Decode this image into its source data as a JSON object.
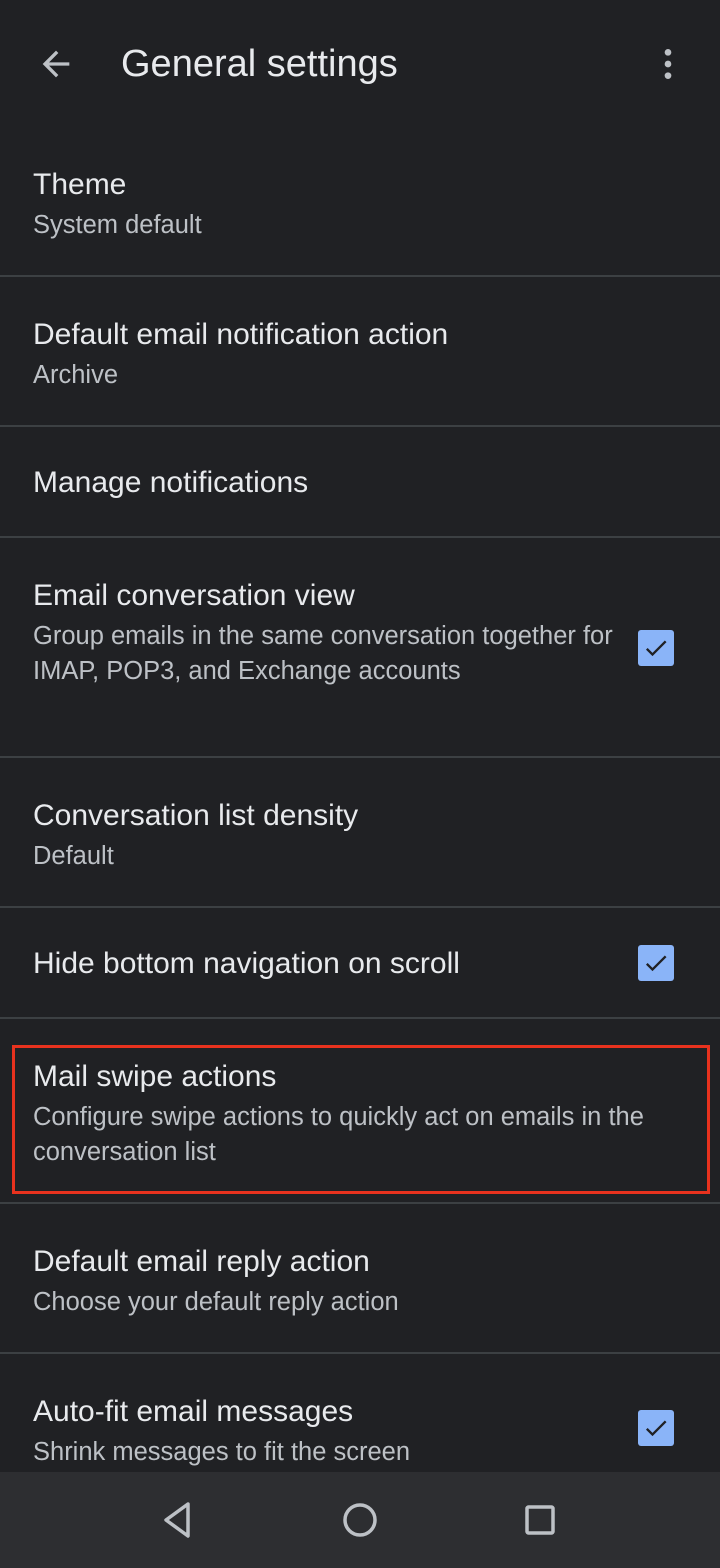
{
  "app_bar": {
    "title": "General settings",
    "back_icon": "arrow-left-icon",
    "overflow_icon": "more-vert-icon"
  },
  "settings": [
    {
      "label": "Theme",
      "description": "System default",
      "checkbox": null
    },
    {
      "label": "Default email notification action",
      "description": "Archive",
      "checkbox": null
    },
    {
      "label": "Manage notifications",
      "description": "",
      "checkbox": null
    },
    {
      "label": "Email conversation view",
      "description": "Group emails in the same conversation together for IMAP, POP3, and Exchange accounts",
      "checkbox": true
    },
    {
      "label": "Conversation list density",
      "description": "Default",
      "checkbox": null
    },
    {
      "label": "Hide bottom navigation on scroll",
      "description": "",
      "checkbox": true
    },
    {
      "label": "Mail swipe actions",
      "description": "Configure swipe actions to quickly act on emails in the conversation list",
      "checkbox": null,
      "highlighted": true
    },
    {
      "label": "Default email reply action",
      "description": "Choose your default reply action",
      "checkbox": null
    },
    {
      "label": "Auto-fit email messages",
      "description": "Shrink messages to fit the screen",
      "checkbox": true
    }
  ],
  "nav_bar": {
    "back_icon": "nav-back-triangle-icon",
    "home_icon": "nav-home-circle-icon",
    "recents_icon": "nav-recents-square-icon"
  },
  "colors": {
    "background": "#202124",
    "divider": "#3c4043",
    "checkbox": "#8ab4f8",
    "highlight": "#e8321e",
    "nav_bar": "#2d2e31"
  }
}
